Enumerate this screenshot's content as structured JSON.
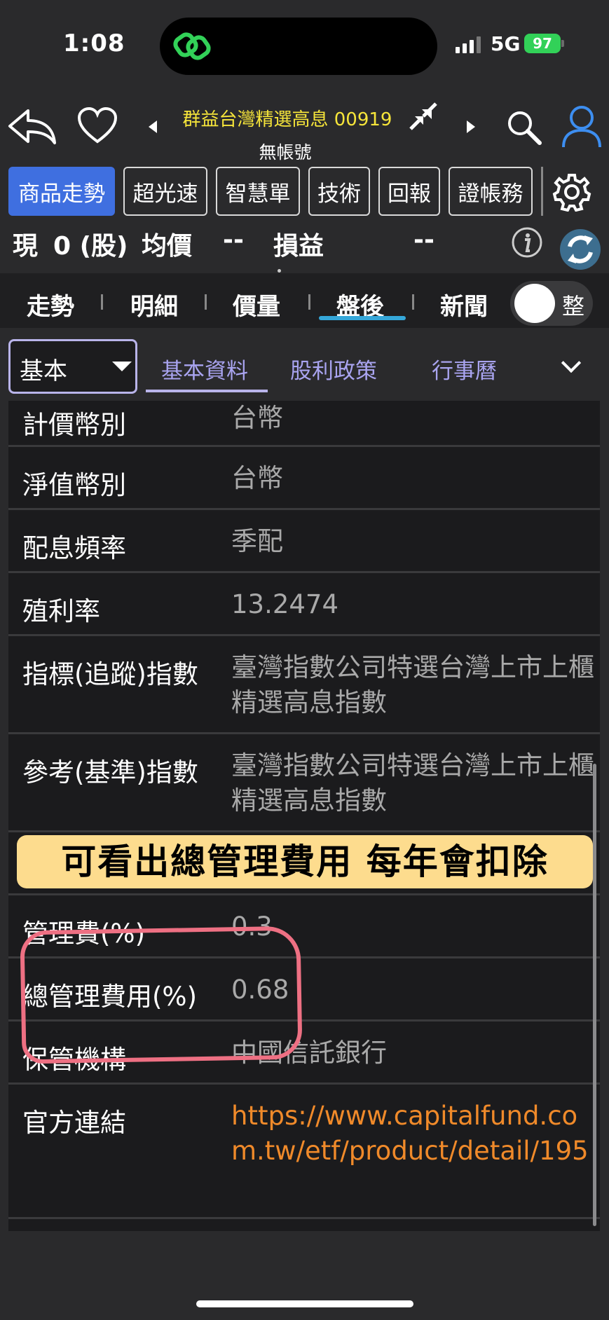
{
  "status": {
    "time": "1:08",
    "network": "5G",
    "battery": "97"
  },
  "header": {
    "title": "群益台灣精選高息 00919",
    "account": "無帳號",
    "toolbar": [
      "商品走勢",
      "超光速",
      "智慧單",
      "技術",
      "回報",
      "證帳務"
    ],
    "position": {
      "now_label": "現",
      "qty": "0 (股)",
      "avg_label": "均價",
      "avg_value": "--",
      "pnl_label": "損益",
      "pnl_value": "--"
    }
  },
  "tabs": [
    "走勢",
    "明細",
    "價量",
    "盤後",
    "新聞"
  ],
  "active_tab": "盤後",
  "toggle_label": "整",
  "subnav": {
    "select_value": "基本",
    "items": [
      "基本資料",
      "股利政策",
      "行事曆"
    ]
  },
  "rows": [
    {
      "key": "計價幣別",
      "value": "台幣"
    },
    {
      "key": "淨值幣別",
      "value": "台幣"
    },
    {
      "key": "配息頻率",
      "value": "季配"
    },
    {
      "key": "殖利率",
      "value": "13.2474"
    },
    {
      "key": "指標(追蹤)指數",
      "value": "臺灣指數公司特選台灣上市上櫃精選高息指數"
    },
    {
      "key": "參考(基準)指數",
      "value": "臺灣指數公司特選台灣上市上櫃精選高息指數"
    },
    {
      "key": "",
      "value": ""
    },
    {
      "key": "管理費(%)",
      "value": "0.3"
    },
    {
      "key": "總管理費用(%)",
      "value": "0.68"
    },
    {
      "key": "保管機構",
      "value": "中國信託銀行"
    },
    {
      "key": "官方連結",
      "value": "https://www.capitalfund.com.tw/etf/product/detail/195"
    }
  ],
  "annotation": {
    "banner": "可看出總管理費用 每年會扣除",
    "color": "#ee7083",
    "banner_color": "#fddc8e"
  },
  "colors": {
    "accent_blue": "#3f6fe0",
    "title_yellow": "#f6e53a",
    "link_orange": "#f08a2a",
    "sub_purple": "#a9a4f0"
  }
}
